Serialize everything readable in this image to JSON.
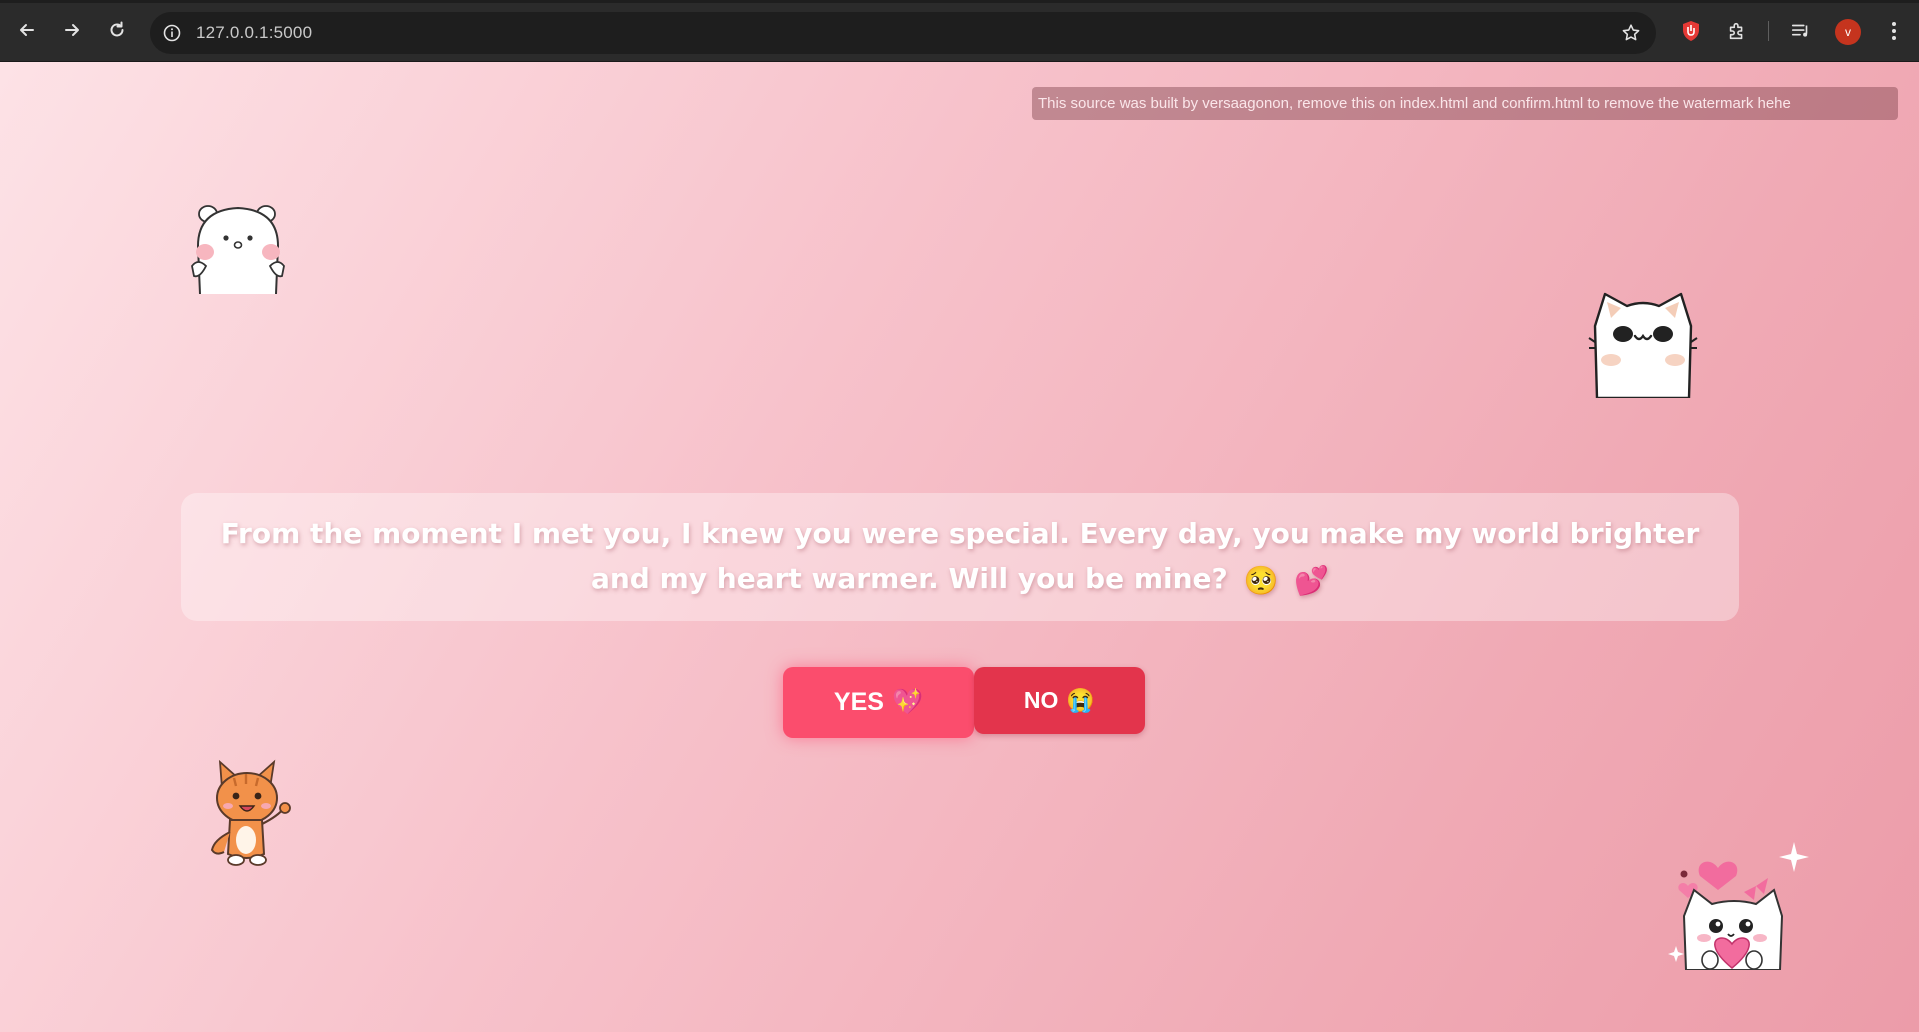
{
  "browser": {
    "url": "127.0.0.1:5000",
    "avatar_initial": "v",
    "icons": [
      "back-arrow-icon",
      "forward-arrow-icon",
      "reload-icon",
      "site-info-icon",
      "bookmark-star-icon",
      "extension-red-icon",
      "puzzle-extensions-icon",
      "media-controls-icon",
      "profile-avatar",
      "kebab-menu-icon"
    ]
  },
  "page": {
    "watermark": "This source was built by versaagonon, remove this on index.html and confirm.html to remove the watermark hehe",
    "message": "From the moment I met you, I knew you were special. Every day, you make my world brighter and my heart warmer. Will you be mine?",
    "message_emojis": [
      "🥺",
      "💕"
    ],
    "yes_button": {
      "label": "YES",
      "emoji": "💖"
    },
    "no_button": {
      "label": "NO",
      "emoji": "😭"
    },
    "stickers": [
      "white-bear-sticker",
      "white-cat-sticker",
      "orange-cat-sticker",
      "heart-cat-sticker"
    ]
  },
  "colors": {
    "yes": "#fb4d6d",
    "no": "#e3344c",
    "background_start": "#fde2e6",
    "background_end": "#ec9ca9"
  }
}
